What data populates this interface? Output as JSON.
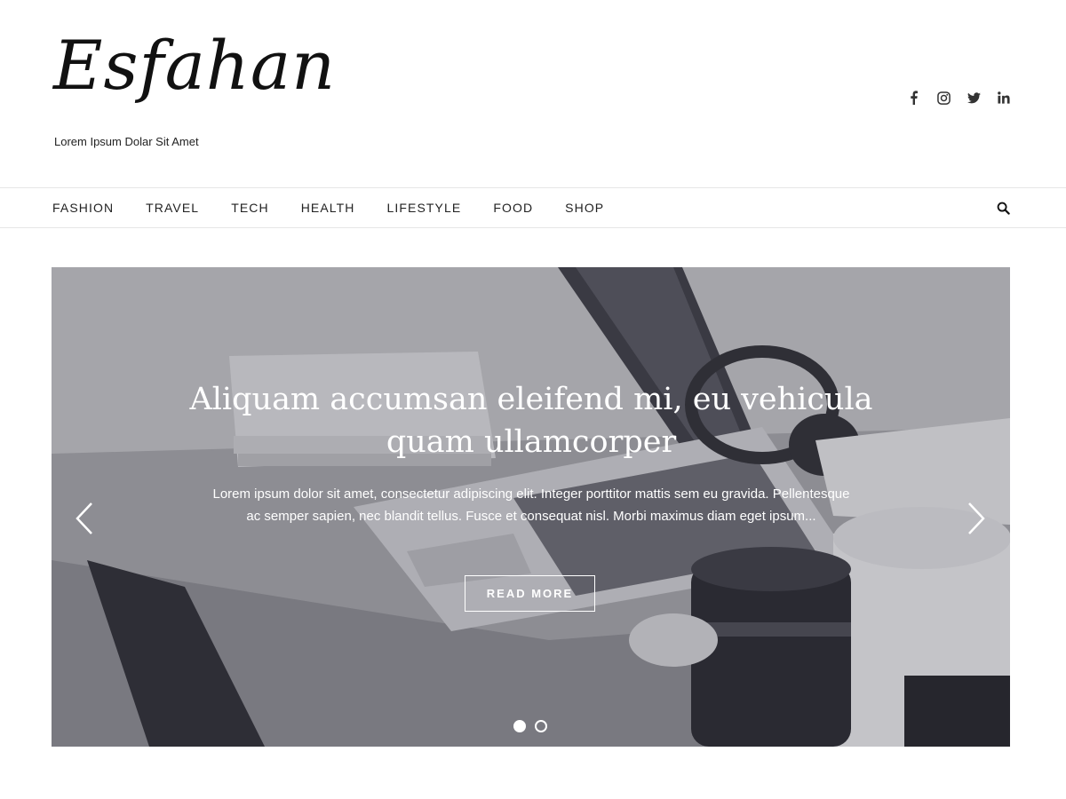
{
  "site": {
    "logo_text": "Esfahan",
    "tagline": "Lorem Ipsum Dolar Sit Amet"
  },
  "social_icons": [
    "facebook-icon",
    "instagram-icon",
    "twitter-icon",
    "linkedin-icon"
  ],
  "nav": {
    "items": [
      "FASHION",
      "TRAVEL",
      "TECH",
      "HEALTH",
      "LIFESTYLE",
      "FOOD",
      "SHOP"
    ]
  },
  "slider": {
    "title": "Aliquam accumsan eleifend mi, eu vehicula quam ullamcorper",
    "excerpt": "Lorem ipsum dolor sit amet, consectetur adipiscing elit. Integer porttitor mattis sem eu gravida. Pellentesque ac semper sapien, nec blandit tellus. Fusce et consequat nisl. Morbi maximus diam eget ipsum...",
    "button_label": "READ MORE",
    "slide_count": 2,
    "active_slide": 1
  },
  "colors": {
    "text": "#222222",
    "border": "#e6e6e6",
    "slide_text": "#ffffff"
  }
}
